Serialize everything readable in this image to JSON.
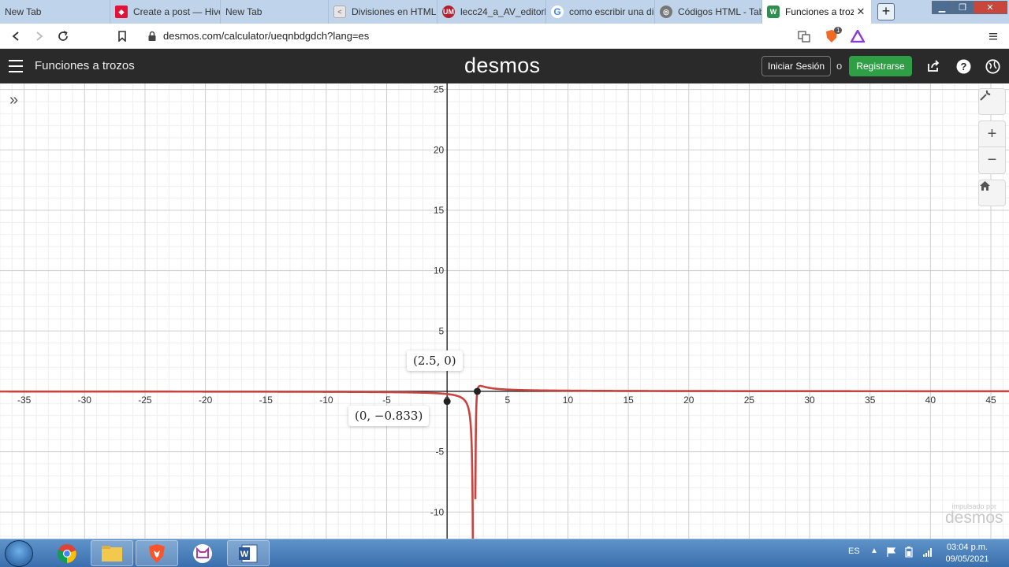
{
  "browser": {
    "tabs": [
      {
        "label": "New Tab",
        "icon": "new-tab-icon",
        "active": false
      },
      {
        "label": "Create a post — Hive",
        "icon": "hive-icon",
        "active": false
      },
      {
        "label": "New Tab",
        "icon": "new-tab-icon",
        "active": false
      },
      {
        "label": "Divisiones en HTML",
        "icon": "page-icon",
        "active": false
      },
      {
        "label": "lecc24_a_AV_editorh",
        "icon": "um-icon",
        "active": false
      },
      {
        "label": "como escribir una di",
        "icon": "google-icon",
        "active": false
      },
      {
        "label": "Códigos HTML - Tab",
        "icon": "globe-icon",
        "active": false
      },
      {
        "label": "Funciones a troz",
        "icon": "desmos-icon",
        "active": true
      }
    ],
    "url": "desmos.com/calculator/ueqnbdgdch?lang=es",
    "shield_count": "1"
  },
  "desmos": {
    "graph_title": "Funciones a trozos",
    "logo": "desmos",
    "login_label": "Iniciar Sesión",
    "or_text": "o",
    "signup_label": "Registrarse",
    "powered_small": "impulsado por",
    "powered_brand": "desmos",
    "point_labels": [
      "(2.5, 0)",
      "(0, −0.833)"
    ]
  },
  "chart_data": {
    "type": "line",
    "xlim": [
      -37,
      46.5
    ],
    "ylim": [
      -12.2,
      25.5
    ],
    "x_ticks": [
      -35,
      -30,
      -25,
      -20,
      -15,
      -10,
      -5,
      0,
      5,
      10,
      15,
      20,
      25,
      30,
      35,
      40,
      45
    ],
    "y_ticks": [
      -10,
      -5,
      5,
      10,
      15,
      20,
      25
    ],
    "grid": true,
    "series": [
      {
        "expression": "y = (x - 2.5) / (x - 2)^2 - 0.2 (approximate shape)",
        "color": "#c74440",
        "vertical_asymptote": 2.25
      }
    ],
    "points": [
      {
        "x": 2.5,
        "y": 0,
        "label": "(2.5, 0)"
      },
      {
        "x": 0,
        "y": -0.833,
        "label": "(0, −0.833)"
      }
    ]
  },
  "taskbar": {
    "language": "ES",
    "time": "03:04 p.m.",
    "date": "09/05/2021"
  }
}
